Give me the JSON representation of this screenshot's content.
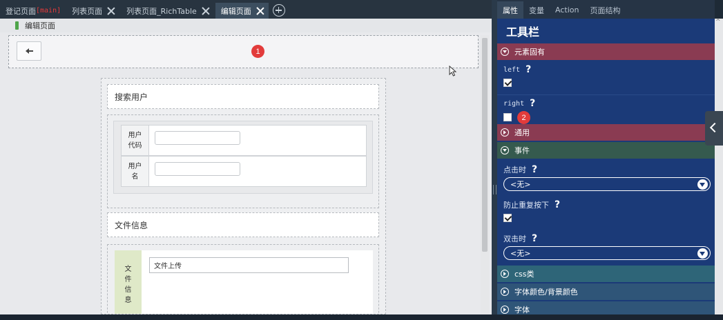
{
  "tabs": [
    {
      "label": "登记页面",
      "suffix": "[main]"
    },
    {
      "label": "列表页面"
    },
    {
      "label": "列表页面_RichTable"
    },
    {
      "label": "编辑页面"
    }
  ],
  "breadcrumb": "编辑页面",
  "badges": {
    "toolbar": "1",
    "right_checkbox": "2"
  },
  "form": {
    "search_title": "搜索用户",
    "fields": [
      {
        "label": "用户代码"
      },
      {
        "label": "用户名"
      }
    ],
    "file_title": "文件信息",
    "file_label": "文件信息",
    "file_input": "文件上传"
  },
  "props": {
    "tabs": [
      "属性",
      "变量",
      "Action",
      "页面结构"
    ],
    "title": "工具栏",
    "sections": {
      "builtin": "元素固有",
      "general": "通用",
      "events": "事件",
      "css": "css类",
      "colors": "字体颜色/背景颜色",
      "font": "字体"
    },
    "left": {
      "label": "left",
      "checked": true
    },
    "right": {
      "label": "right",
      "checked": false
    },
    "on_click": {
      "label": "点击时",
      "value": "<无>"
    },
    "prevent_repeat": {
      "label": "防止重复按下",
      "checked": true
    },
    "on_dblclick": {
      "label": "双击时",
      "value": "<无>"
    }
  },
  "colors": {
    "accent_red": "#e23b3b",
    "panel_blue": "#1b3a78"
  }
}
